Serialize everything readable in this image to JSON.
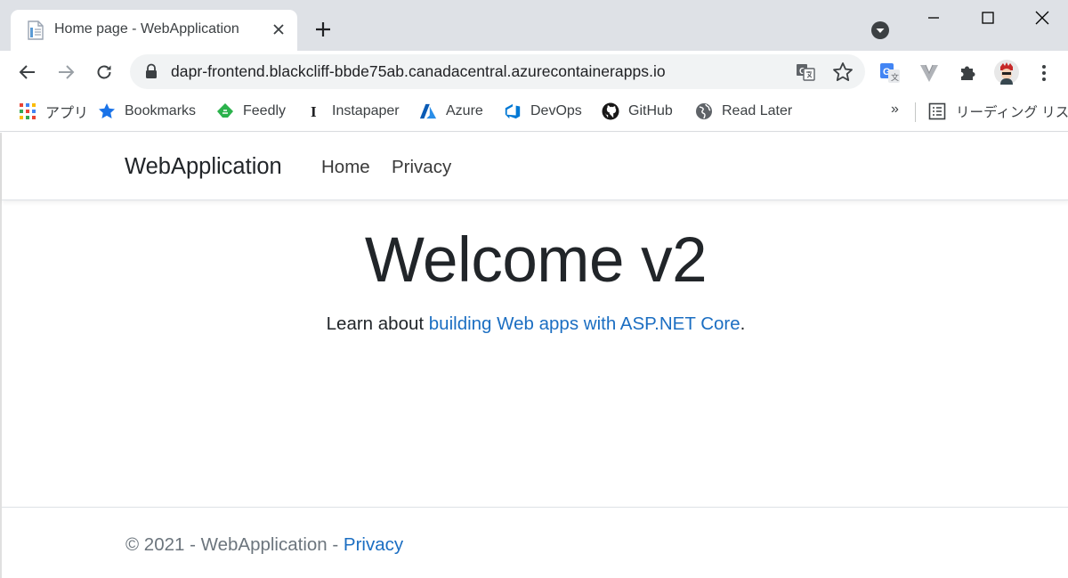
{
  "browser": {
    "tab": {
      "title": "Home page - WebApplication"
    },
    "toolbar": {
      "url": "dapr-frontend.blackcliff-bbde75ab.canadacentral.azurecontainerapps.io"
    },
    "bookmarks": [
      {
        "label": "アプリ",
        "icon": "apps-grid-icon"
      },
      {
        "label": "Bookmarks",
        "icon": "star-icon"
      },
      {
        "label": "Feedly",
        "icon": "feedly-icon"
      },
      {
        "label": "Instapaper",
        "icon": "instapaper-icon"
      },
      {
        "label": "Azure",
        "icon": "azure-icon"
      },
      {
        "label": "DevOps",
        "icon": "devops-icon"
      },
      {
        "label": "GitHub",
        "icon": "github-icon"
      },
      {
        "label": "Read Later",
        "icon": "globe-icon"
      }
    ],
    "more_bookmarks": "»",
    "reading_list": "リーディング リスト",
    "colors": {
      "tabstrip": "#dee1e6",
      "omnibox": "#f1f3f4",
      "link": "#1b6ec2"
    }
  },
  "site": {
    "brand": "WebApplication",
    "nav": {
      "home": "Home",
      "privacy": "Privacy"
    },
    "hero": {
      "title": "Welcome v2",
      "intro_prefix": "Learn about ",
      "intro_link": "building Web apps with ASP.NET Core",
      "intro_suffix": "."
    },
    "footer": {
      "copyright": "© 2021 - WebApplication - ",
      "privacy_link": "Privacy"
    }
  }
}
